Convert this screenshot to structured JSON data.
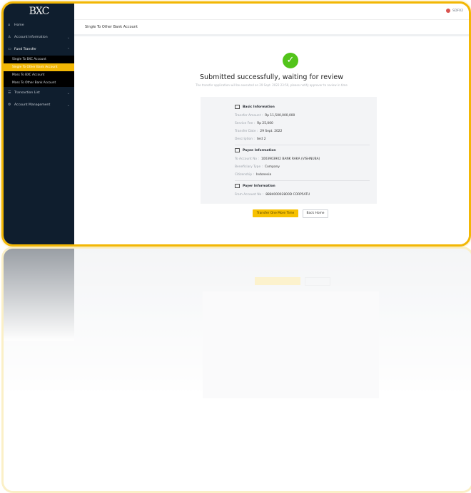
{
  "brand": {
    "logo_text": "BXC",
    "accent": "#f2b705",
    "sidebar_bg": "#0f1e2e"
  },
  "header": {
    "user_name": "SDF02",
    "page_title": "Single To Other Bank Account"
  },
  "sidebar": {
    "items": [
      {
        "label": "Home",
        "icon": "home-icon"
      },
      {
        "label": "Account Information",
        "icon": "user-icon"
      },
      {
        "label": "Fund Transfer",
        "icon": "card-icon"
      },
      {
        "label": "Transaction List",
        "icon": "list-icon"
      },
      {
        "label": "Account Management",
        "icon": "settings-icon"
      }
    ],
    "fund_transfer_sub": [
      {
        "label": "Single To BXC Account"
      },
      {
        "label": "Single To Other Bank Account"
      },
      {
        "label": "Mass To BXC Account"
      },
      {
        "label": "Mass To Other Bank Account"
      }
    ]
  },
  "result": {
    "headline": "Submitted successfully, waiting for review",
    "subline": "The transfer application will be executed on 29 Sept. 2022 23:59, please notify approver to review in time"
  },
  "basic": {
    "title": "Basic Information",
    "rows": [
      {
        "label": "Transfer Amount :",
        "value": "Rp 11,500,000,000"
      },
      {
        "label": "Service Fee :",
        "value": "Rp 25,000"
      },
      {
        "label": "Transfer Date :",
        "value": "29 Sept. 2022"
      },
      {
        "label": "Description :",
        "value": "test 2"
      }
    ]
  },
  "payee": {
    "title": "Payee Information",
    "rows": [
      {
        "label": "To Account No :",
        "value": "1003903902 BANK RAKA (VISHNUBA)"
      },
      {
        "label": "Beneficiary Type :",
        "value": "Company"
      },
      {
        "label": "Citizenship :",
        "value": "Indonesia"
      }
    ]
  },
  "payer": {
    "title": "Payer Information",
    "rows": [
      {
        "label": "From Account No :",
        "value": "888400002800D CORP5ATU"
      }
    ]
  },
  "actions": {
    "primary": "Transfer One More Time",
    "secondary": "Back Home"
  }
}
